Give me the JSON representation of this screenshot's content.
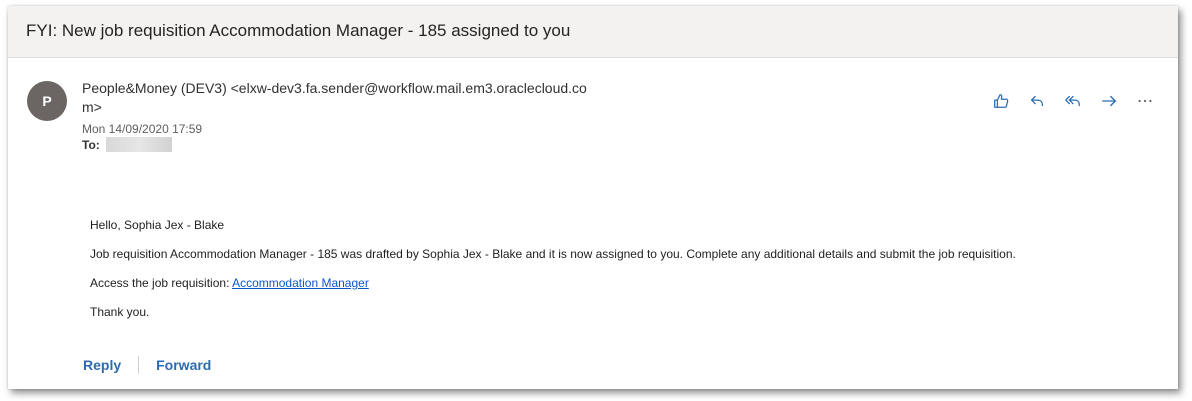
{
  "email": {
    "subject": "FYI: New job requisition Accommodation Manager - 185 assigned to you",
    "avatar_initial": "P",
    "sender_line1": "People&Money (DEV3) <elxw-dev3.fa.sender@workflow.mail.em3.oraclecloud.co",
    "sender_line2": "m>",
    "date": "Mon 14/09/2020 17:59",
    "to_label": "To:",
    "body": {
      "greeting": "Hello, Sophia Jex - Blake",
      "paragraph": "Job requisition Accommodation Manager - 185 was drafted by Sophia Jex - Blake and it is now assigned to you. Complete any additional details and submit the job requisition.",
      "access_prefix": "Access the job requisition: ",
      "access_link": "Accommodation Manager",
      "thanks": "Thank you."
    }
  },
  "actions": {
    "icons": [
      "like-icon",
      "reply-icon",
      "reply-all-icon",
      "forward-icon",
      "more-icon"
    ],
    "accent_color": "#2b6cb0"
  },
  "footer": {
    "reply_label": "Reply",
    "forward_label": "Forward"
  }
}
